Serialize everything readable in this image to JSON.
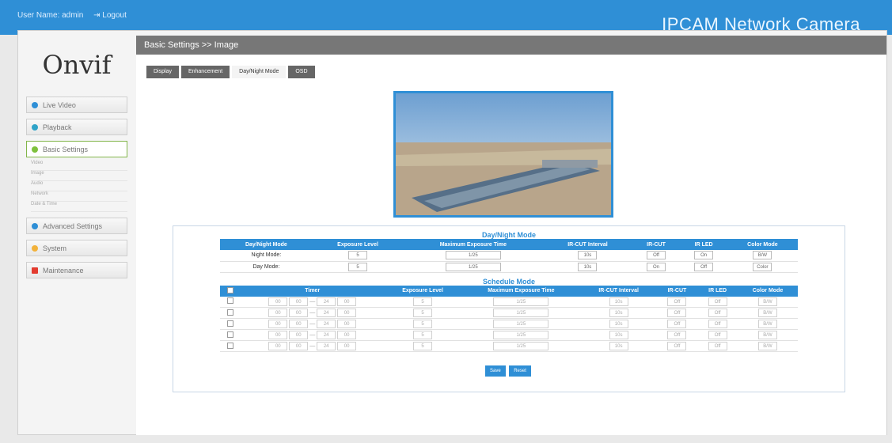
{
  "topbar": {
    "user": "User Name: admin",
    "logout": "⇥ Logout",
    "brand": "IPCAM Network Camera"
  },
  "sidebar": {
    "logo": "Onvif",
    "items": [
      {
        "label": "Live Video",
        "icon": "video-icon",
        "color": "#2f8fd6"
      },
      {
        "label": "Playback",
        "icon": "play-icon",
        "color": "#2fa3c8"
      },
      {
        "label": "Basic Settings",
        "icon": "settings-icon",
        "color": "#7ec13d"
      },
      {
        "label": "Advanced Settings",
        "icon": "settings-plus-icon",
        "color": "#2f8fd6"
      },
      {
        "label": "System",
        "icon": "system-icon",
        "color": "#f2b23b"
      },
      {
        "label": "Maintenance",
        "icon": "tools-icon",
        "color": "#e33b2f"
      }
    ],
    "subitems": [
      "Video",
      "Image",
      "Audio",
      "Network",
      "Date & Time"
    ]
  },
  "breadcrumb": "Basic Settings >> Image",
  "tabs": [
    "Display",
    "Enhancement",
    "Day/Night Mode",
    "OSD"
  ],
  "daynight": {
    "title": "Day/Night Mode",
    "headers": [
      "Day/Night Mode",
      "Exposure Level",
      "Maximum Exposure Time",
      "IR-CUT Interval",
      "IR-CUT",
      "IR LED",
      "Color Mode"
    ],
    "rows": [
      {
        "label": "Night Mode:",
        "exposure": "5",
        "max": "1/25",
        "interval": "10s",
        "ircut": "Off",
        "irled": "On",
        "color": "B/W"
      },
      {
        "label": "Day Mode:",
        "exposure": "5",
        "max": "1/25",
        "interval": "10s",
        "ircut": "On",
        "irled": "Off",
        "color": "Color"
      }
    ]
  },
  "schedule": {
    "title": "Schedule Mode",
    "headers": [
      "Timer",
      "Exposure Level",
      "Maximum Exposure Time",
      "IR-CUT Interval",
      "IR-CUT",
      "IR LED",
      "Color Mode"
    ],
    "row": {
      "h1": "00",
      "m1": "00",
      "h2": "24",
      "m2": "00",
      "dash": "—",
      "exposure": "5",
      "max": "1/25",
      "interval": "10s",
      "ircut": "Off",
      "irled": "Off",
      "color": "B/W"
    }
  },
  "buttons": {
    "save": "Save",
    "reset": "Reset"
  }
}
